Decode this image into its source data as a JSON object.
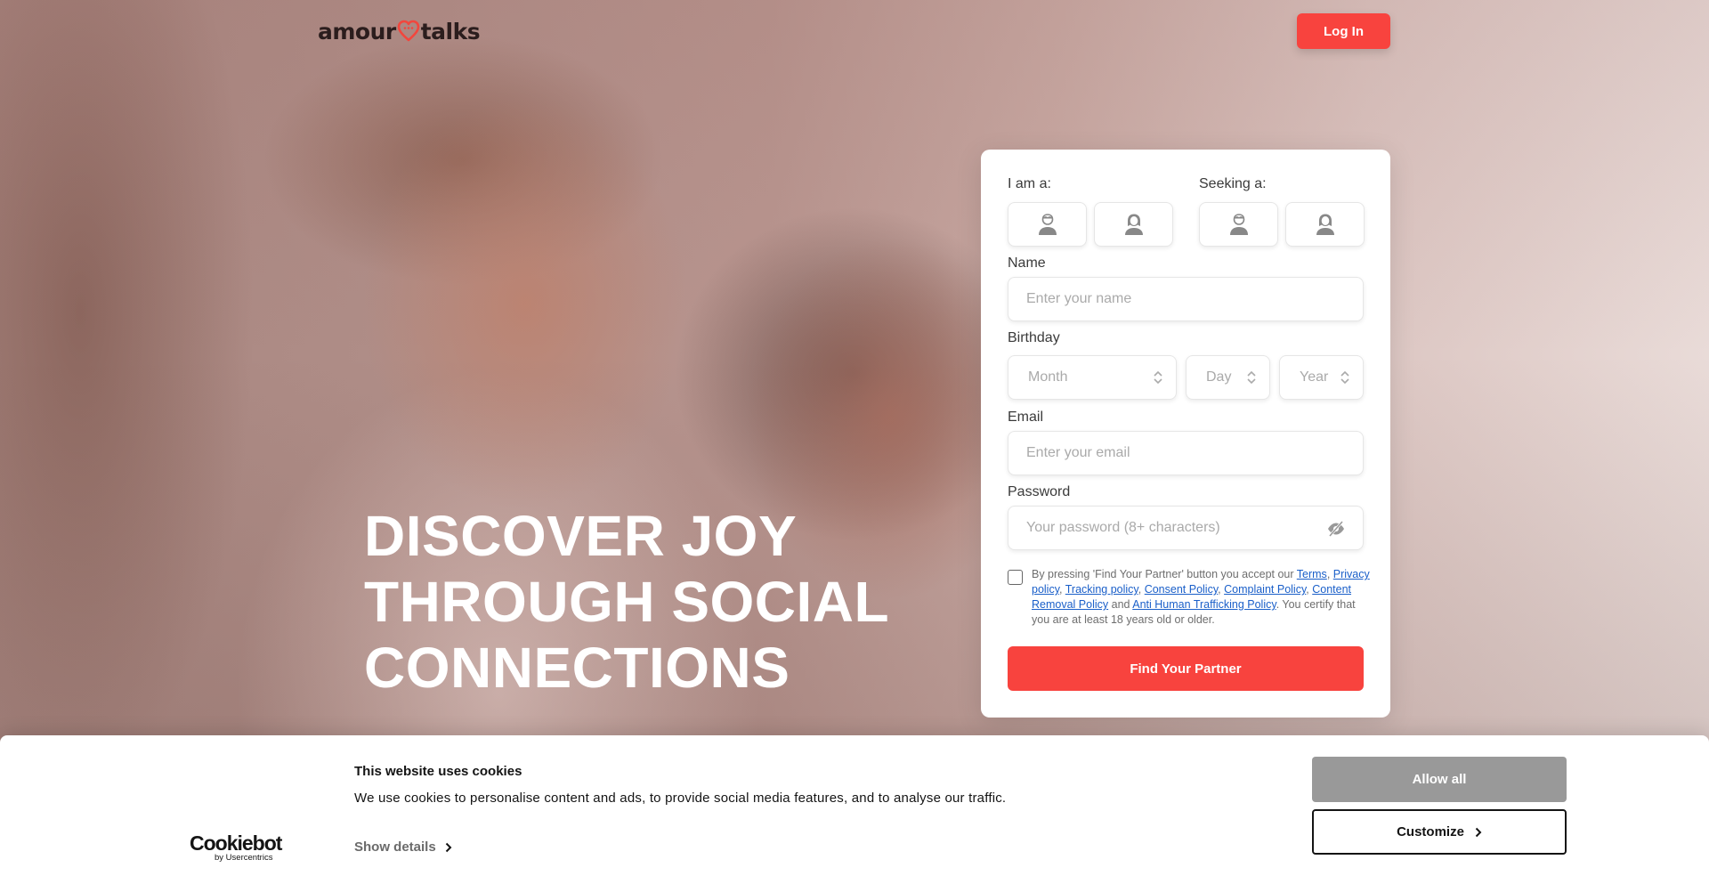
{
  "header": {
    "logo_left": "amour",
    "logo_right": "talks",
    "login_label": "Log In"
  },
  "hero": {
    "headline_lines": [
      "DISCOVER JOY",
      "THROUGH SOCIAL",
      "CONNECTIONS"
    ]
  },
  "form": {
    "iam_label": "I am a:",
    "seeking_label": "Seeking a:",
    "name_label": "Name",
    "name_placeholder": "Enter your name",
    "birthday_label": "Birthday",
    "month_placeholder": "Month",
    "day_placeholder": "Day",
    "year_placeholder": "Year",
    "email_label": "Email",
    "email_placeholder": "Enter your email",
    "password_label": "Password",
    "password_placeholder": "Your password (8+ characters)",
    "terms": {
      "intro": "By pressing 'Find Your Partner' button you accept our ",
      "terms_link": "Terms",
      "sep1": ", ",
      "privacy_link": "Privacy policy",
      "sep2": ", ",
      "tracking_link": "Tracking policy",
      "sep3": ", ",
      "consent_link": "Consent Policy",
      "sep4": ", ",
      "complaint_link": "Complaint Policy",
      "sep5": ", ",
      "removal_link": "Content Removal Policy",
      "sep6": " and ",
      "trafficking_link": "Anti Human Trafficking Policy",
      "outro": ". You certify that you are at least 18 years old or older."
    },
    "submit_label": "Find Your Partner"
  },
  "cookie_banner": {
    "logo_main": "Cookiebot",
    "logo_sub": "by Usercentrics",
    "title": "This website uses cookies",
    "text": "We use cookies to personalise content and ads, to provide social media features, and to analyse our traffic.",
    "details_label": "Show details",
    "allow_label": "Allow all",
    "customize_label": "Customize"
  },
  "colors": {
    "accent": "#f8433e",
    "link": "#1a5fc9",
    "allow_button": "#999999"
  },
  "icons": {
    "gender": [
      "male-avatar-icon",
      "female-avatar-icon",
      "male-avatar-icon",
      "female-avatar-icon"
    ],
    "password": "eye-slash-icon",
    "select": "updown-chevron-icon",
    "details": "chevron-right-icon",
    "logo": "heart-chat-icon"
  }
}
